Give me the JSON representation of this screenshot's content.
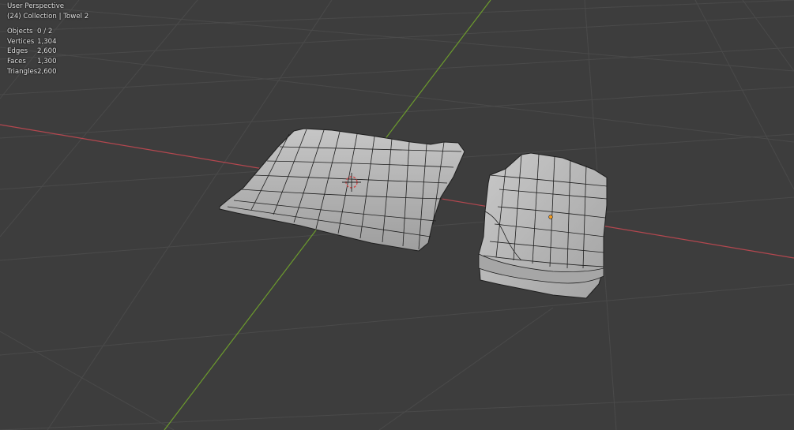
{
  "viewport": {
    "view_name": "User Perspective",
    "collection_info": "(24) Collection | Towel 2",
    "stats": [
      {
        "label": "Objects",
        "value": "0 / 2"
      },
      {
        "label": "Vertices",
        "value": "1,304"
      },
      {
        "label": "Edges",
        "value": "2,600"
      },
      {
        "label": "Faces",
        "value": "1,300"
      },
      {
        "label": "Triangles",
        "value": "2,600"
      }
    ]
  },
  "colors": {
    "background": "#3d3d3d",
    "grid_line": "#4a4a4a",
    "x_axis": "#b4474f",
    "y_axis": "#6c9b2d",
    "mesh_face": "#b8b8b8",
    "mesh_wire": "#1e1e1e",
    "origin_dot": "#f29a1f"
  }
}
